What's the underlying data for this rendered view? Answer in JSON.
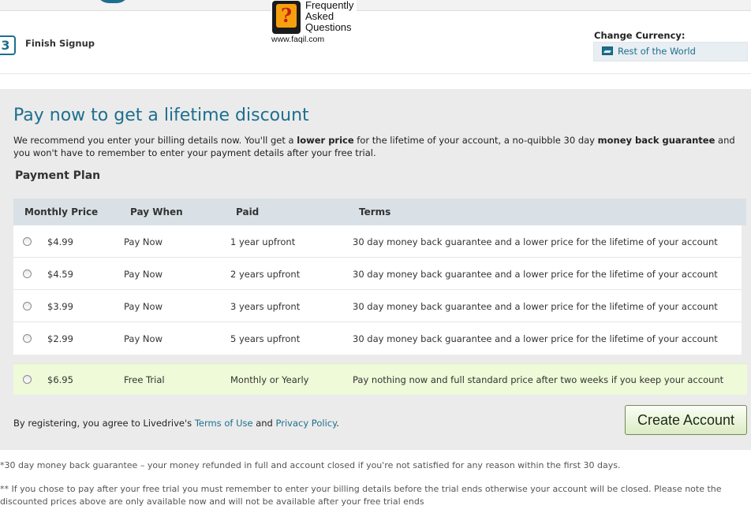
{
  "header": {
    "step_number": "3",
    "step_label": "Finish Signup"
  },
  "faq_logo": {
    "line1": "Frequently",
    "line2": "Asked",
    "line3": "Questions",
    "url": "www.faqil.com",
    "glyph": "?"
  },
  "currency": {
    "title": "Change Currency:",
    "selected": "Rest of the World",
    "icon": "flag-icon"
  },
  "main": {
    "headline": "Pay now to get a lifetime discount",
    "intro_1": "We recommend you enter your billing details now. You'll get a ",
    "intro_bold_1": "lower price",
    "intro_2": " for the lifetime of your account, a no-quibble 30 day ",
    "intro_bold_2": "money back guarantee",
    "intro_3": " and you won't have to remember to enter your payment details after your free trial.",
    "plan_title": "Payment Plan"
  },
  "table": {
    "headers": [
      "Monthly Price",
      "Pay When",
      "Paid",
      "Terms"
    ],
    "rows": [
      {
        "price": "$4.99",
        "when": "Pay Now",
        "paid": "1 year upfront",
        "terms": "30 day money back guarantee and a lower price for the lifetime of your account"
      },
      {
        "price": "$4.59",
        "when": "Pay Now",
        "paid": "2 years upfront",
        "terms": "30 day money back guarantee and a lower price for the lifetime of your account"
      },
      {
        "price": "$3.99",
        "when": "Pay Now",
        "paid": "3 years upfront",
        "terms": "30 day money back guarantee and a lower price for the lifetime of your account"
      },
      {
        "price": "$2.99",
        "when": "Pay Now",
        "paid": "5 years upfront",
        "terms": "30 day money back guarantee and a lower price for the lifetime of your account"
      }
    ],
    "trial": {
      "price": "$6.95",
      "when": "Free Trial",
      "paid": "Monthly or Yearly",
      "terms": "Pay nothing now and full standard price after two weeks if you keep your account"
    }
  },
  "agreement": {
    "prefix": "By registering, you agree to Livedrive's ",
    "terms_link": "Terms of Use",
    "middle": " and ",
    "privacy_link": "Privacy Policy",
    "suffix": "."
  },
  "create_button": "Create Account",
  "footnotes": {
    "note1": "*30 day money back guarantee – your money refunded in full and account closed if you're not satisfied for any reason within the first 30 days.",
    "note2": "** If you chose to pay after your free trial you must remember to enter your billing details before the trial ends otherwise your account will be closed. Please note the discounted prices above are only available now and will not be available after your free trial ends"
  },
  "colors": {
    "accent": "#1d6f8f",
    "panel_bg": "#ebebeb",
    "table_header_bg": "#d9e1e6",
    "trial_row_bg": "#eefad8"
  }
}
